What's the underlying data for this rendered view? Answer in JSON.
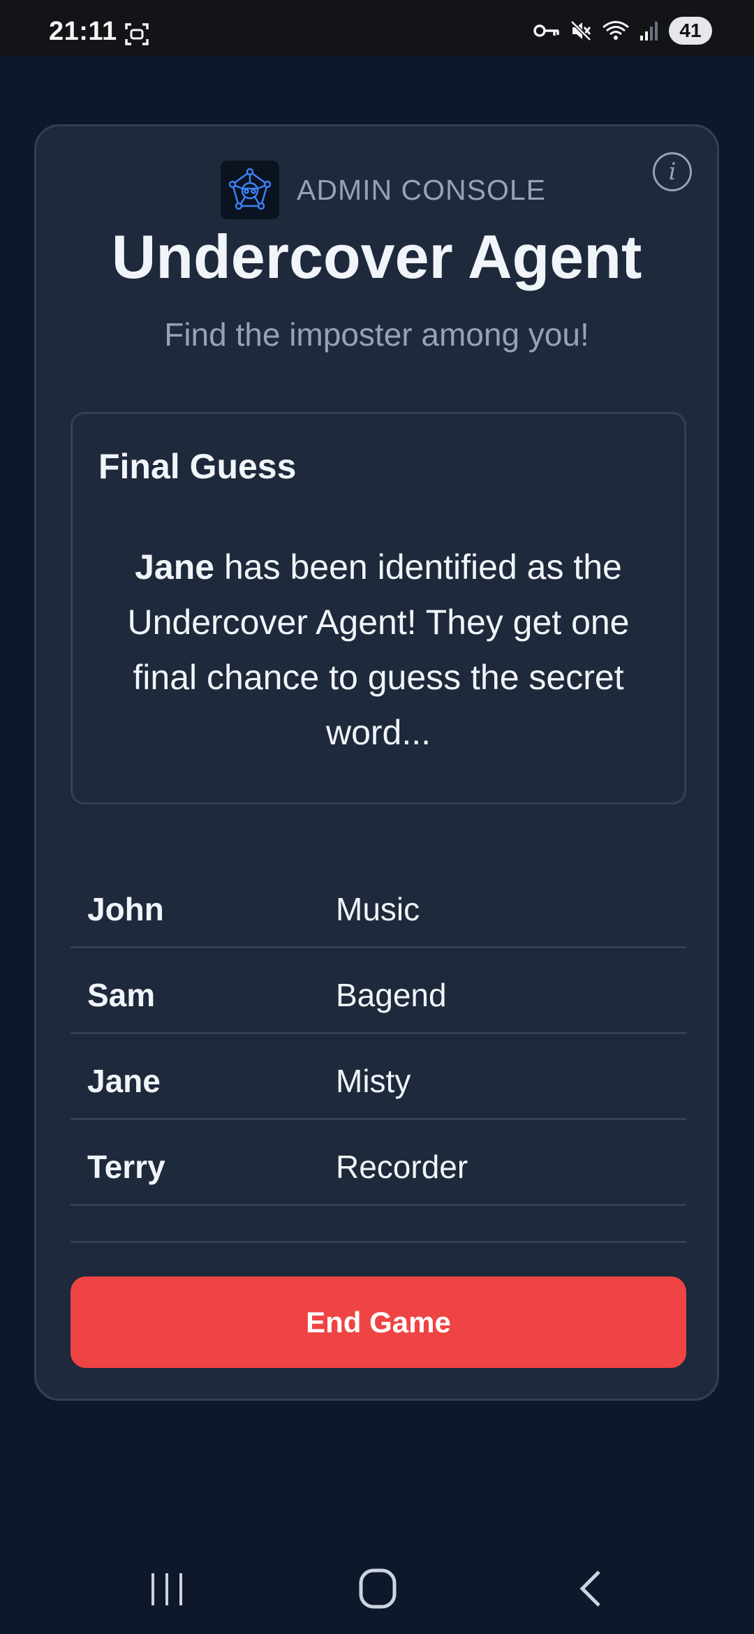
{
  "status_bar": {
    "time": "21:11",
    "battery": "41",
    "icons": [
      "screenshot-icon",
      "vpn-key-icon",
      "mute-icon",
      "wifi-icon",
      "signal-icon"
    ]
  },
  "header": {
    "admin_label": "ADMIN CONSOLE",
    "title": "Undercover Agent",
    "subtitle": "Find the imposter among you!",
    "logo_icon": "agent-network-icon",
    "info_icon_glyph": "i"
  },
  "final_guess": {
    "heading": "Final Guess",
    "agent_name": "Jane",
    "message": " has been identified as the Undercover Agent! They get one final chance to guess the secret word..."
  },
  "players": [
    {
      "name": "John",
      "word": "Music"
    },
    {
      "name": "Sam",
      "word": "Bagend"
    },
    {
      "name": "Jane",
      "word": "Misty"
    },
    {
      "name": "Terry",
      "word": "Recorder"
    }
  ],
  "actions": {
    "end_game_label": "End Game"
  },
  "colors": {
    "background": "#0f172a",
    "card": "#1e293b",
    "border": "#334155",
    "accent_red": "#ef4444",
    "muted_text": "#94a3b8",
    "logo_blue": "#3b82f6"
  }
}
